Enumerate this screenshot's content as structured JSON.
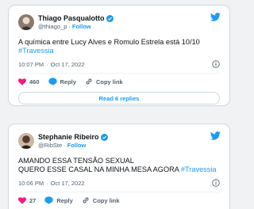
{
  "colors": {
    "accent": "#1d9bf0",
    "like": "#f91880",
    "muted": "#536471"
  },
  "tweets": [
    {
      "name": "Thiago Pasqualotto",
      "handle": "@thiago_p",
      "follow": "Follow",
      "text": "A química entre Lucy Alves e Romulo Estrela está 10/10",
      "hashtag": "#Travessia",
      "time": "10:07 PM",
      "date": "Oct 17, 2022",
      "likes": "460",
      "reply_label": "Reply",
      "copy_label": "Copy link",
      "read_replies": "Read 6 replies",
      "icons": [
        "avatar",
        "verified-badge-icon",
        "twitter-bird-icon",
        "info-icon",
        "heart-icon",
        "reply-icon",
        "link-icon"
      ]
    },
    {
      "name": "Stephanie Ribeiro",
      "handle": "@RibSte",
      "follow": "Follow",
      "text": "AMANDO ESSA TENSÃO SEXUAL\nQUERO ESSE CASAL NA MINHA MESA AGORA",
      "hashtag": "#Travessia",
      "time": "10:06 PM",
      "date": "Oct 17, 2022",
      "likes": "27",
      "reply_label": "Reply",
      "copy_label": "Copy link",
      "icons": [
        "avatar",
        "verified-badge-icon",
        "twitter-bird-icon",
        "info-icon",
        "heart-icon",
        "reply-icon",
        "link-icon"
      ]
    }
  ]
}
